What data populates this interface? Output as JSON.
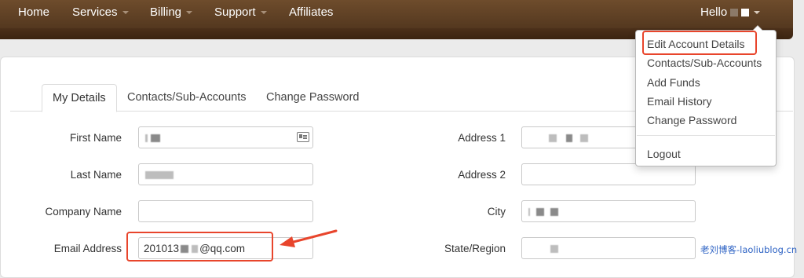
{
  "navbar": {
    "items": [
      {
        "label": "Home",
        "dropdown": false
      },
      {
        "label": "Services",
        "dropdown": true
      },
      {
        "label": "Billing",
        "dropdown": true
      },
      {
        "label": "Support",
        "dropdown": true
      },
      {
        "label": "Affiliates",
        "dropdown": false
      }
    ],
    "user_greeting": "Hello"
  },
  "account_menu": {
    "items": [
      "Edit Account Details",
      "Contacts/Sub-Accounts",
      "Add Funds",
      "Email History",
      "Change Password"
    ],
    "logout": "Logout",
    "highlighted_item": "Edit Account Details"
  },
  "tabs": [
    {
      "label": "My Details",
      "active": true
    },
    {
      "label": "Contacts/Sub-Accounts",
      "active": false
    },
    {
      "label": "Change Password",
      "active": false
    }
  ],
  "form": {
    "left": {
      "first_name_label": "First Name",
      "last_name_label": "Last Name",
      "company_name_label": "Company Name",
      "email_label": "Email Address",
      "email_value_prefix": "201013",
      "email_value_suffix": "@qq.com"
    },
    "right": {
      "address1_label": "Address 1",
      "address2_label": "Address 2",
      "city_label": "City",
      "state_label": "State/Region"
    }
  },
  "watermark": "老刘博客-laoliublog.cn",
  "colors": {
    "navbar": "#6e4c2c",
    "highlight": "#e8452c",
    "watermark": "#2e63c4"
  }
}
